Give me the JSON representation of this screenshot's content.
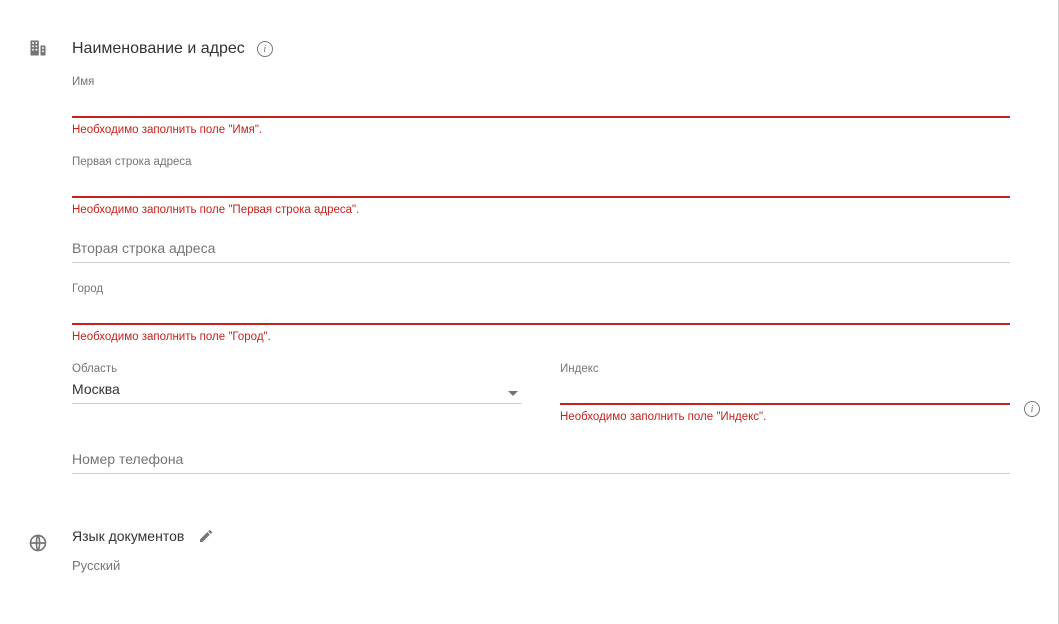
{
  "nameAddress": {
    "title": "Наименование и адрес",
    "name": {
      "label": "Имя",
      "value": "",
      "error": "Необходимо заполнить поле \"Имя\"."
    },
    "line1": {
      "label": "Первая строка адреса",
      "value": "",
      "error": "Необходимо заполнить поле \"Первая строка адреса\"."
    },
    "line2": {
      "placeholder": "Вторая строка адреса",
      "value": ""
    },
    "city": {
      "label": "Город",
      "value": "",
      "error": "Необходимо заполнить поле \"Город\"."
    },
    "region": {
      "label": "Область",
      "value": "Москва"
    },
    "postal": {
      "label": "Индекс",
      "value": "",
      "error": "Необходимо заполнить поле \"Индекс\"."
    },
    "phone": {
      "placeholder": "Номер телефона",
      "value": ""
    }
  },
  "language": {
    "title": "Язык документов",
    "value": "Русский"
  }
}
